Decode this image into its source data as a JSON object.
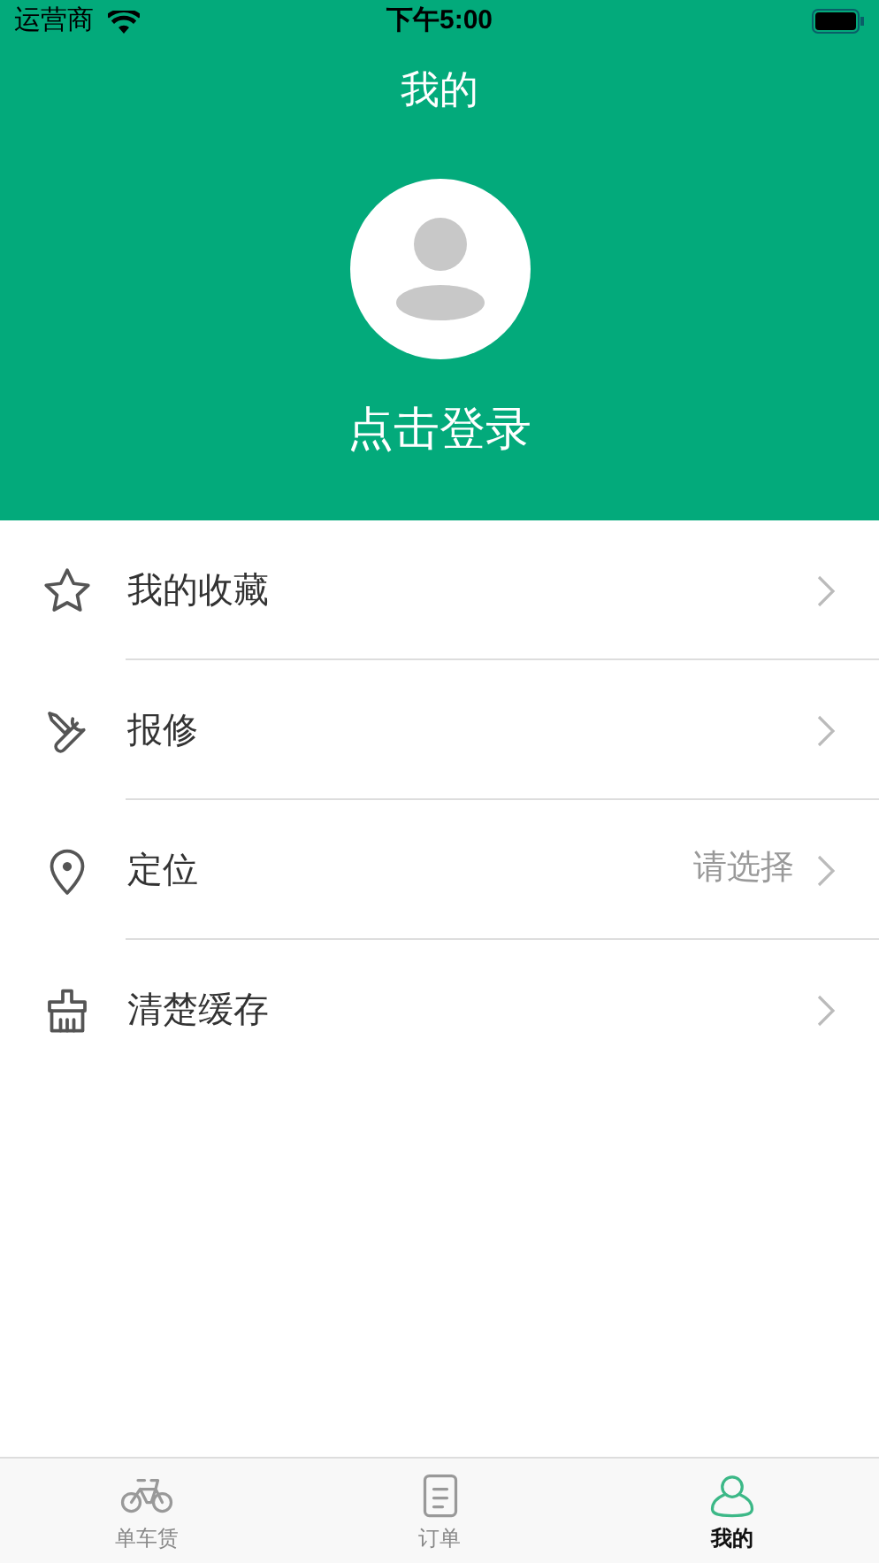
{
  "status_bar": {
    "carrier": "运营商",
    "time": "下午5:00"
  },
  "header": {
    "title": "我的",
    "login": "点击登录"
  },
  "menu": [
    {
      "kind": "star",
      "label": "我的收藏"
    },
    {
      "kind": "tools",
      "label": "报修"
    },
    {
      "kind": "pin",
      "label": "定位",
      "value": "请选择"
    },
    {
      "kind": "broom",
      "label": "清楚缓存"
    }
  ],
  "tabs": [
    {
      "kind": "bike",
      "label": "单车赁",
      "selected": false
    },
    {
      "kind": "order",
      "label": "订单",
      "selected": false
    },
    {
      "kind": "user",
      "label": "我的",
      "selected": true
    }
  ]
}
